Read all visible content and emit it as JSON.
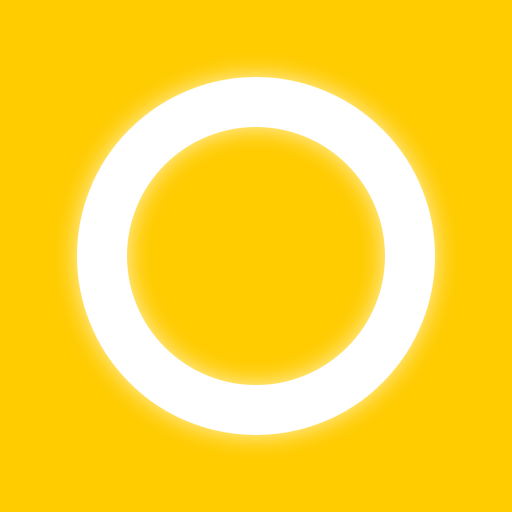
{
  "colors": {
    "background": "#FFCC00",
    "ring": "#FFFFFF",
    "glow": "#FFFFFF"
  },
  "icon": {
    "name": "ring-icon"
  }
}
